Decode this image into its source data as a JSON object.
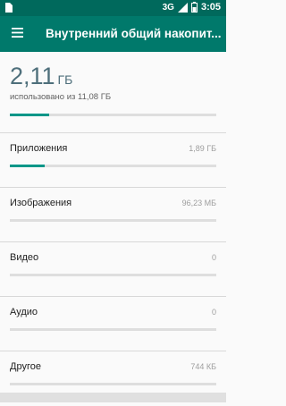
{
  "status_bar": {
    "network": "3G",
    "time": "3:05"
  },
  "toolbar": {
    "title": "Внутренний общий накопит..."
  },
  "summary": {
    "used": "2,11",
    "unit": "ГБ",
    "caption": "использовано из 11,08 ГБ",
    "fraction": 0.19
  },
  "categories": [
    {
      "label": "Приложения",
      "value": "1,89 ГБ",
      "fraction": 0.17
    },
    {
      "label": "Изображения",
      "value": "96,23 МБ",
      "fraction": 0.0
    },
    {
      "label": "Видео",
      "value": "0",
      "fraction": 0.0
    },
    {
      "label": "Аудио",
      "value": "0",
      "fraction": 0.0
    },
    {
      "label": "Другое",
      "value": "744 КБ",
      "fraction": 0.0
    }
  ],
  "colors": {
    "status_bar": "#00695c",
    "toolbar": "#00796b",
    "accent": "#009688"
  }
}
